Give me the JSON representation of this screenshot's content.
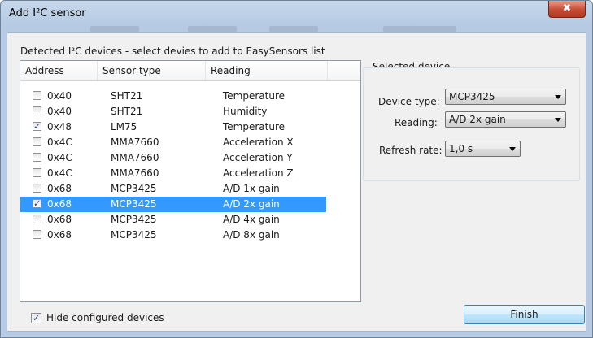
{
  "window": {
    "title": "Add I²C sensor",
    "close_glyph": "✖"
  },
  "devices_group": {
    "label": "Detected I²C devices - select devies to add to EasySensors list",
    "columns": [
      "Address",
      "Sensor type",
      "Reading"
    ],
    "rows": [
      {
        "checked": false,
        "selected": false,
        "address": "0x40",
        "sensor": "SHT21",
        "reading": "Temperature"
      },
      {
        "checked": false,
        "selected": false,
        "address": "0x40",
        "sensor": "SHT21",
        "reading": "Humidity"
      },
      {
        "checked": true,
        "selected": false,
        "address": "0x48",
        "sensor": "LM75",
        "reading": "Temperature"
      },
      {
        "checked": false,
        "selected": false,
        "address": "0x4C",
        "sensor": "MMA7660",
        "reading": "Acceleration X"
      },
      {
        "checked": false,
        "selected": false,
        "address": "0x4C",
        "sensor": "MMA7660",
        "reading": "Acceleration Y"
      },
      {
        "checked": false,
        "selected": false,
        "address": "0x4C",
        "sensor": "MMA7660",
        "reading": "Acceleration Z"
      },
      {
        "checked": false,
        "selected": false,
        "address": "0x68",
        "sensor": "MCP3425",
        "reading": "A/D 1x gain"
      },
      {
        "checked": true,
        "selected": true,
        "address": "0x68",
        "sensor": "MCP3425",
        "reading": "A/D 2x gain"
      },
      {
        "checked": false,
        "selected": false,
        "address": "0x68",
        "sensor": "MCP3425",
        "reading": "A/D 4x gain"
      },
      {
        "checked": false,
        "selected": false,
        "address": "0x68",
        "sensor": "MCP3425",
        "reading": "A/D 8x gain"
      }
    ]
  },
  "selected_device": {
    "legend": "Selected device",
    "device_type_label": "Device type:",
    "device_type_value": "MCP3425",
    "reading_label": "Reading:",
    "reading_value": "A/D 2x gain",
    "refresh_label": "Refresh rate:",
    "refresh_value": "1,0 s"
  },
  "footer": {
    "hide_configured_label": "Hide configured devices",
    "hide_configured_checked": true,
    "finish_label": "Finish"
  },
  "colors": {
    "selection": "#3399ff",
    "title_bar": "#b6cbe3",
    "close_button": "#c74a32"
  }
}
